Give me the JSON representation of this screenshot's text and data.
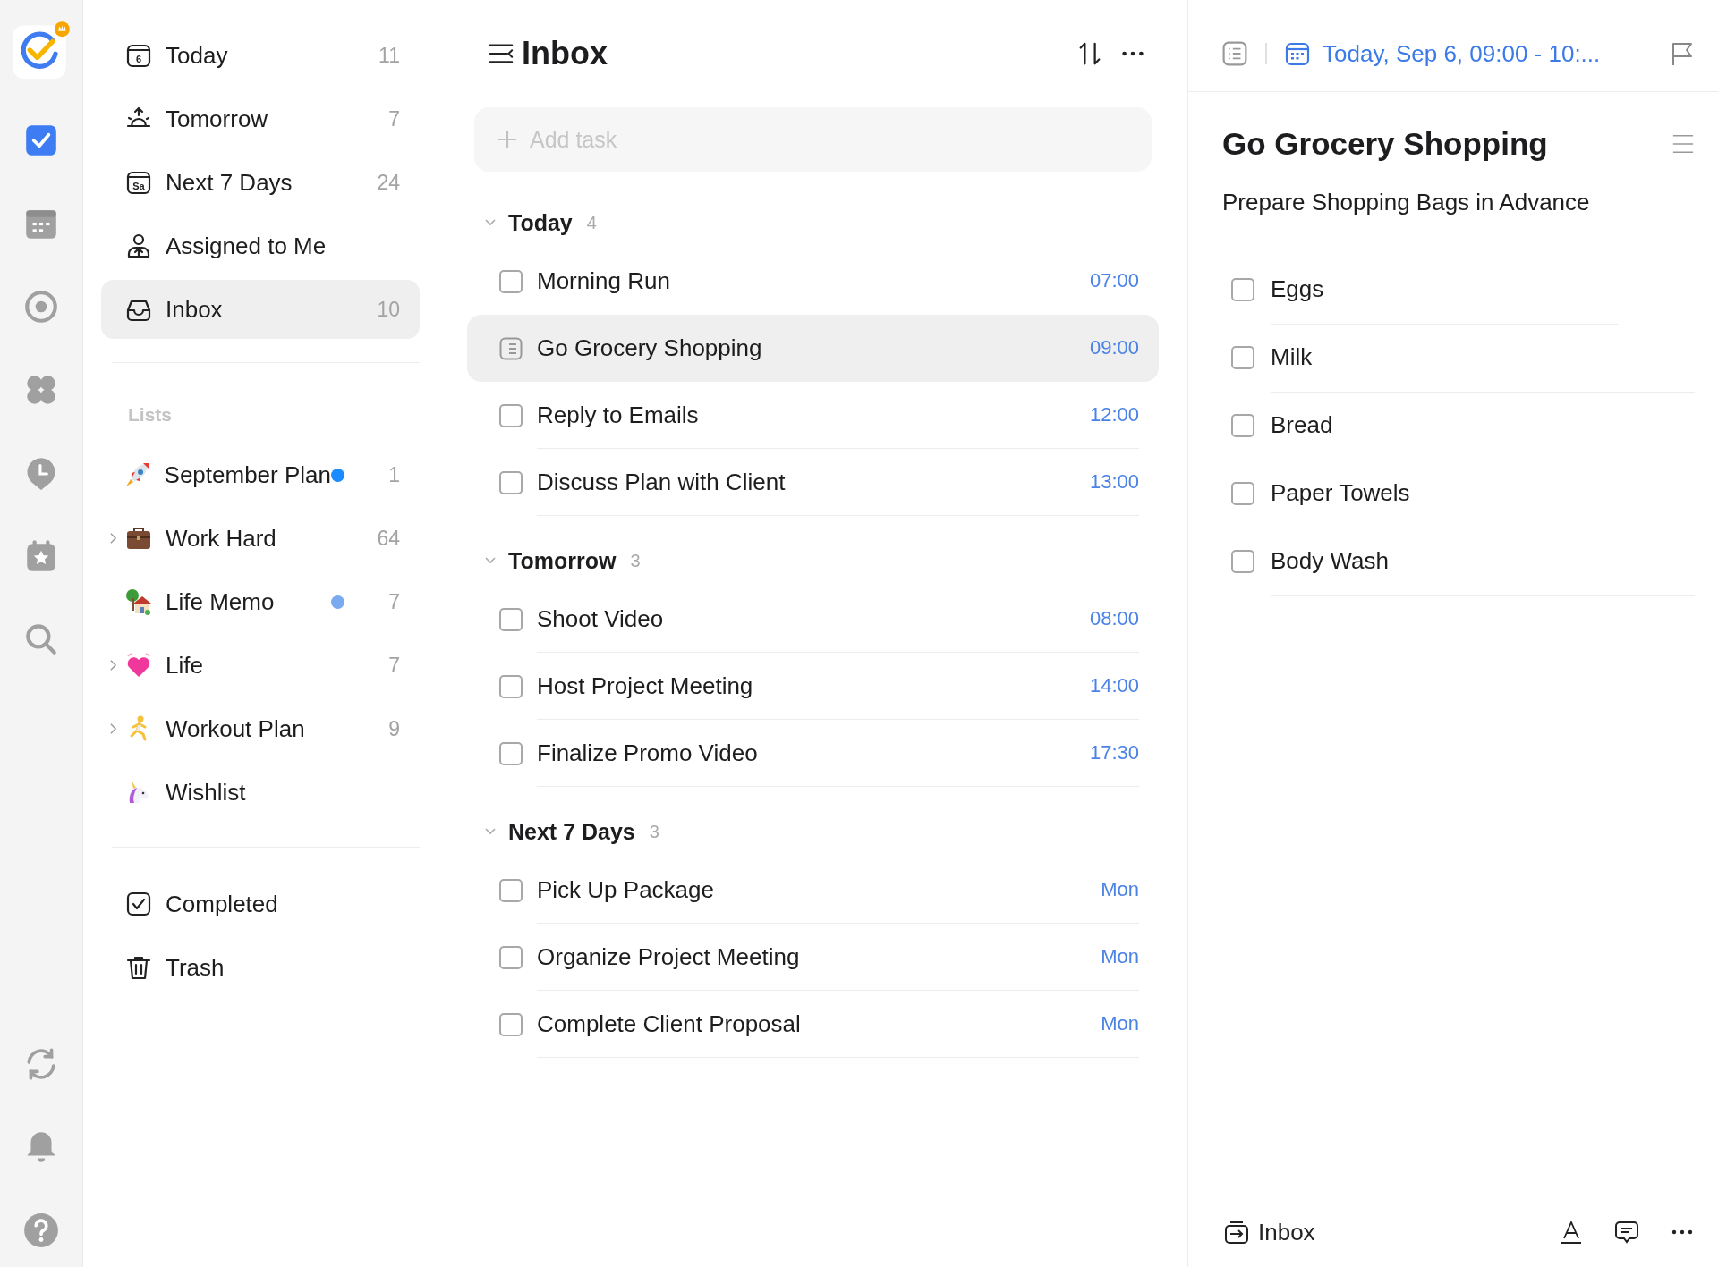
{
  "rail": [
    {
      "selected": true
    },
    {
      "selected": false
    },
    {
      "selected": false
    },
    {
      "selected": false
    },
    {
      "selected": false
    },
    {
      "selected": false
    },
    {
      "selected": false
    }
  ],
  "smart_lists": [
    {
      "label": "Today",
      "icon_label": "6",
      "count": "11",
      "selected": false
    },
    {
      "label": "Tomorrow",
      "count": "7",
      "selected": false
    },
    {
      "label": "Next 7 Days",
      "icon_label": "Sa",
      "count": "24",
      "selected": false
    },
    {
      "label": "Assigned to Me",
      "selected": false
    },
    {
      "label": "Inbox",
      "count": "10",
      "selected": true
    }
  ],
  "lists_heading": "Lists",
  "lists": [
    {
      "label": "September Plan",
      "color": "#1a8cff",
      "count": "1",
      "expandable": false,
      "selected": false
    },
    {
      "label": "Work Hard",
      "count": "64",
      "expandable": true,
      "selected": false
    },
    {
      "label": "Life Memo",
      "color": "#7aaaf0",
      "count": "7",
      "expandable": false,
      "selected": false
    },
    {
      "label": "Life",
      "count": "7",
      "expandable": true,
      "selected": false
    },
    {
      "label": "Workout Plan",
      "count": "9",
      "expandable": true,
      "selected": false
    },
    {
      "label": "Wishlist",
      "expandable": false,
      "selected": false
    }
  ],
  "bottom_lists": [
    {
      "label": "Completed",
      "selected": false
    },
    {
      "label": "Trash",
      "selected": false
    }
  ],
  "main": {
    "title": "Inbox",
    "add_task": {
      "placeholder": "Add task"
    },
    "sections": [
      {
        "title": "Today",
        "count": "4",
        "expanded": true,
        "tasks": [
          {
            "title": "Morning Run",
            "time": "07:00",
            "kind": "task",
            "checked": false,
            "selected": false
          },
          {
            "title": "Go Grocery Shopping",
            "time": "09:00",
            "kind": "note",
            "selected": true
          },
          {
            "title": "Reply to Emails",
            "time": "12:00",
            "kind": "task",
            "checked": false,
            "selected": false
          },
          {
            "title": "Discuss Plan with Client",
            "time": "13:00",
            "kind": "task",
            "checked": false,
            "selected": false
          }
        ]
      },
      {
        "title": "Tomorrow",
        "count": "3",
        "expanded": true,
        "tasks": [
          {
            "title": "Shoot Video",
            "time": "08:00",
            "kind": "task",
            "checked": false,
            "selected": false
          },
          {
            "title": "Host Project Meeting",
            "time": "14:00",
            "kind": "task",
            "checked": false,
            "selected": false
          },
          {
            "title": "Finalize Promo Video",
            "time": "17:30",
            "kind": "task",
            "checked": false,
            "selected": false
          }
        ]
      },
      {
        "title": "Next 7 Days",
        "count": "3",
        "expanded": true,
        "tasks": [
          {
            "title": "Pick Up Package",
            "time": "Mon",
            "kind": "task",
            "checked": false,
            "selected": false
          },
          {
            "title": "Organize Project Meeting",
            "time": "Mon",
            "kind": "task",
            "checked": false,
            "selected": false
          },
          {
            "title": "Complete Client Proposal",
            "time": "Mon",
            "kind": "task",
            "checked": false,
            "selected": false
          }
        ]
      }
    ]
  },
  "detail": {
    "date": "Today, Sep 6, 09:00 - 10:...",
    "title": "Go Grocery Shopping",
    "description": "Prepare Shopping Bags in Advance",
    "checklist": [
      {
        "label": "Eggs",
        "checked": false
      },
      {
        "label": "Milk",
        "checked": false
      },
      {
        "label": "Bread",
        "checked": false
      },
      {
        "label": "Paper Towels",
        "checked": false
      },
      {
        "label": "Body Wash",
        "checked": false
      }
    ],
    "list_name": "Inbox"
  }
}
